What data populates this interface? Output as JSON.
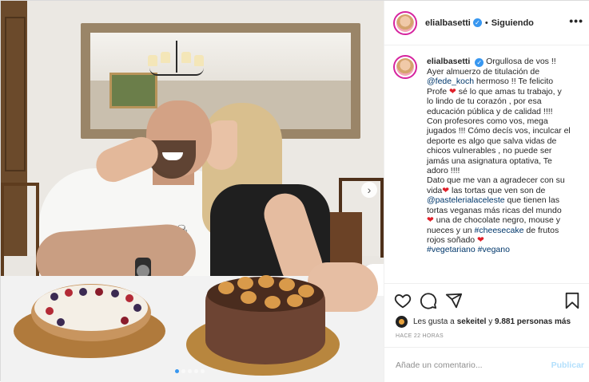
{
  "post": {
    "username": "elialbasetti",
    "separator": "•",
    "follow_status": "Siguiendo",
    "more_label": "•••",
    "next_label": "›",
    "caption_lines": [
      {
        "t": "Orgullosa de vos !!"
      },
      {
        "t": "Ayer almuerzo de titulación de"
      },
      {
        "m": "@fede_koch",
        "t2": " hermoso !! Te felicito"
      },
      {
        "t": "Profe ",
        "heart": true,
        "t2": " sé lo que amas tu trabajo, y"
      },
      {
        "t": "lo lindo de tu corazón , por esa"
      },
      {
        "t": "educación pública y de calidad !!!!"
      },
      {
        "t": "Con profesores como vos, mega"
      },
      {
        "t": "jugados !!! Cómo decís vos, inculcar el"
      },
      {
        "t": "deporte es algo que salva vidas de"
      },
      {
        "t": "chicos vulnerables , no puede ser"
      },
      {
        "t": "jamás una asignatura optativa, Te"
      },
      {
        "t": "adoro !!!!"
      },
      {
        "t": "Dato que me van a agradecer con su"
      },
      {
        "t": "vida",
        "heart": true,
        "t2": " las tortas que ven son de"
      },
      {
        "m": "@pastelerialaceleste",
        "t2": " que tienen las"
      },
      {
        "t": "tortas veganas más ricas del mundo"
      },
      {
        "heart": true,
        "t2": " una de chocolate negro, mouse y"
      },
      {
        "t": "nueces y un ",
        "m": "#cheesecake",
        "t2": " de frutos"
      },
      {
        "t": "rojos soñado ",
        "heart": true
      },
      {
        "m": "#vegetariano",
        "t2": " ",
        "m2": "#vegano"
      }
    ],
    "likes": {
      "prefix": "Les gusta a ",
      "user": "sekeitel",
      "middle": " y ",
      "count": "9.881 personas más"
    },
    "time_ago": "HACE 22 HORAS",
    "comment_placeholder": "Añade un comentario...",
    "publish_label": "Publicar",
    "carousel": {
      "total": 5,
      "active": 0
    }
  },
  "colors": {
    "link": "#00376b",
    "heart": "#e0202a",
    "verified": "#3897f0",
    "publish_disabled": "#b2dffc"
  },
  "icons": [
    "heart-icon",
    "comment-icon",
    "share-icon",
    "bookmark-icon",
    "verified-badge-icon",
    "more-options-icon",
    "chevron-right-icon"
  ]
}
